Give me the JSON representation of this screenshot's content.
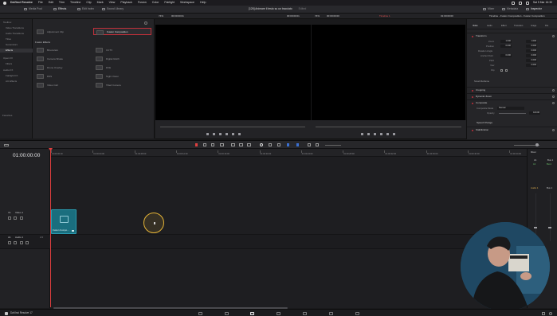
{
  "menubar": {
    "app": "DaVinci Resolve",
    "items": [
      "File",
      "Edit",
      "Trim",
      "Timeline",
      "Clip",
      "Mark",
      "View",
      "Playback",
      "Fusion",
      "Color",
      "Fairlight",
      "Workspace",
      "Help"
    ],
    "clock": "Sat 5 Mar 16:30"
  },
  "toolbar": {
    "media_pool": "Media Pool",
    "effects": "Effects",
    "edit_index": "Edit Index",
    "sound_library": "Sound Library",
    "project_title": "[126] Animare il testo su un tracciato",
    "project_status": "Edited",
    "mixer": "Mixer",
    "metadata": "Metadata",
    "inspector": "Inspector"
  },
  "viewer_header": {
    "zoom_left": "74%",
    "tc_left": "00:00:00:01",
    "tc_left_end": "00:00:00:01",
    "zoom_right": "74%",
    "tc_right_start": "00:00:00:00",
    "timeline_name": "Timeline 1",
    "tc_right": "01:00:00:00",
    "panel_title": "Timeline - Fusion Composition - Fusion Composition"
  },
  "effects_tree": {
    "items": [
      "Toolbox",
      "Video Transitions",
      "Audio Transitions",
      "Titles",
      "Generators",
      "Effects",
      "Open FX",
      "Filters",
      "Audio FX",
      "Fairlight FX",
      "AU Effects"
    ],
    "selected": "Effects",
    "favorites": "Favorites"
  },
  "effects_list": {
    "top_items": [
      "Adjustment Clip",
      "Fusion Composition"
    ],
    "section": "Fusion Effects",
    "fusion_items": [
      "Binoculars",
      "Camera Shake",
      "Drone Overlay",
      "DSS",
      "Video Call",
      "CCTV",
      "Digital Glitch",
      "DVE",
      "Night Vision",
      "Tilted Camera"
    ]
  },
  "inspector": {
    "tabs": [
      "Video",
      "Audio",
      "Effect",
      "Transition",
      "Image",
      "File"
    ],
    "transform": "Transform",
    "rows": [
      {
        "label": "Zoom",
        "x": "1.000",
        "y": "1.000"
      },
      {
        "label": "Position",
        "x": "0.000",
        "y": "0.000"
      },
      {
        "label": "Rotation Angle",
        "x": "",
        "y": "0.000"
      },
      {
        "label": "Anchor Point",
        "x": "0.000",
        "y": "0.000"
      },
      {
        "label": "Pitch",
        "x": "",
        "y": "0.000"
      },
      {
        "label": "Yaw",
        "x": "",
        "y": "0.000"
      },
      {
        "label": "Flip",
        "x": "",
        "y": ""
      }
    ],
    "smart_reframe": "Smart Reframe",
    "cropping": "Cropping",
    "dynamic_zoom": "Dynamic Zoom",
    "composite": "Composite",
    "composite_mode_label": "Composite Mode",
    "composite_mode_value": "Normal",
    "opacity_label": "Opacity",
    "opacity_value": "100.00",
    "speed_change": "Speed Change",
    "stabilization": "Stabilization"
  },
  "timeline": {
    "timecode": "01:00:00:00",
    "ruler_ticks": [
      "01:00:00:00",
      "01:00:04:00",
      "01:00:08:00",
      "01:00:12:00",
      "01:00:16:00",
      "01:00:20:00",
      "01:00:24:00",
      "01:00:28:00",
      "01:00:32:00",
      "01:00:36:00",
      "01:00:40:00",
      "01:00:44:00"
    ],
    "video_track": {
      "id": "V1",
      "name": "Video 1"
    },
    "audio_track": {
      "id": "A1",
      "name": "Audio 1",
      "level": "2.0"
    },
    "clip_name": "Fusion Compo..."
  },
  "mixer": {
    "title": "Mixer",
    "a1": "A1",
    "bus1": "Bus 1",
    "a1_input": "A1",
    "bus_input": "Bus1",
    "audio1": "Audio 1",
    "bus1_lbl": "Bus 1",
    "fader_value": "0.0"
  },
  "pagenav": {
    "app_label": "DaVinci Resolve 17",
    "pages": [
      "media-page",
      "cut-page",
      "edit-page",
      "fusion-page",
      "color-page",
      "fairlight-page",
      "deliver-page"
    ],
    "active": "edit-page"
  },
  "colors": {
    "accent_red": "#c0303a",
    "clip_teal": "#1a6e7e",
    "cursor_ring": "#e5b436"
  }
}
